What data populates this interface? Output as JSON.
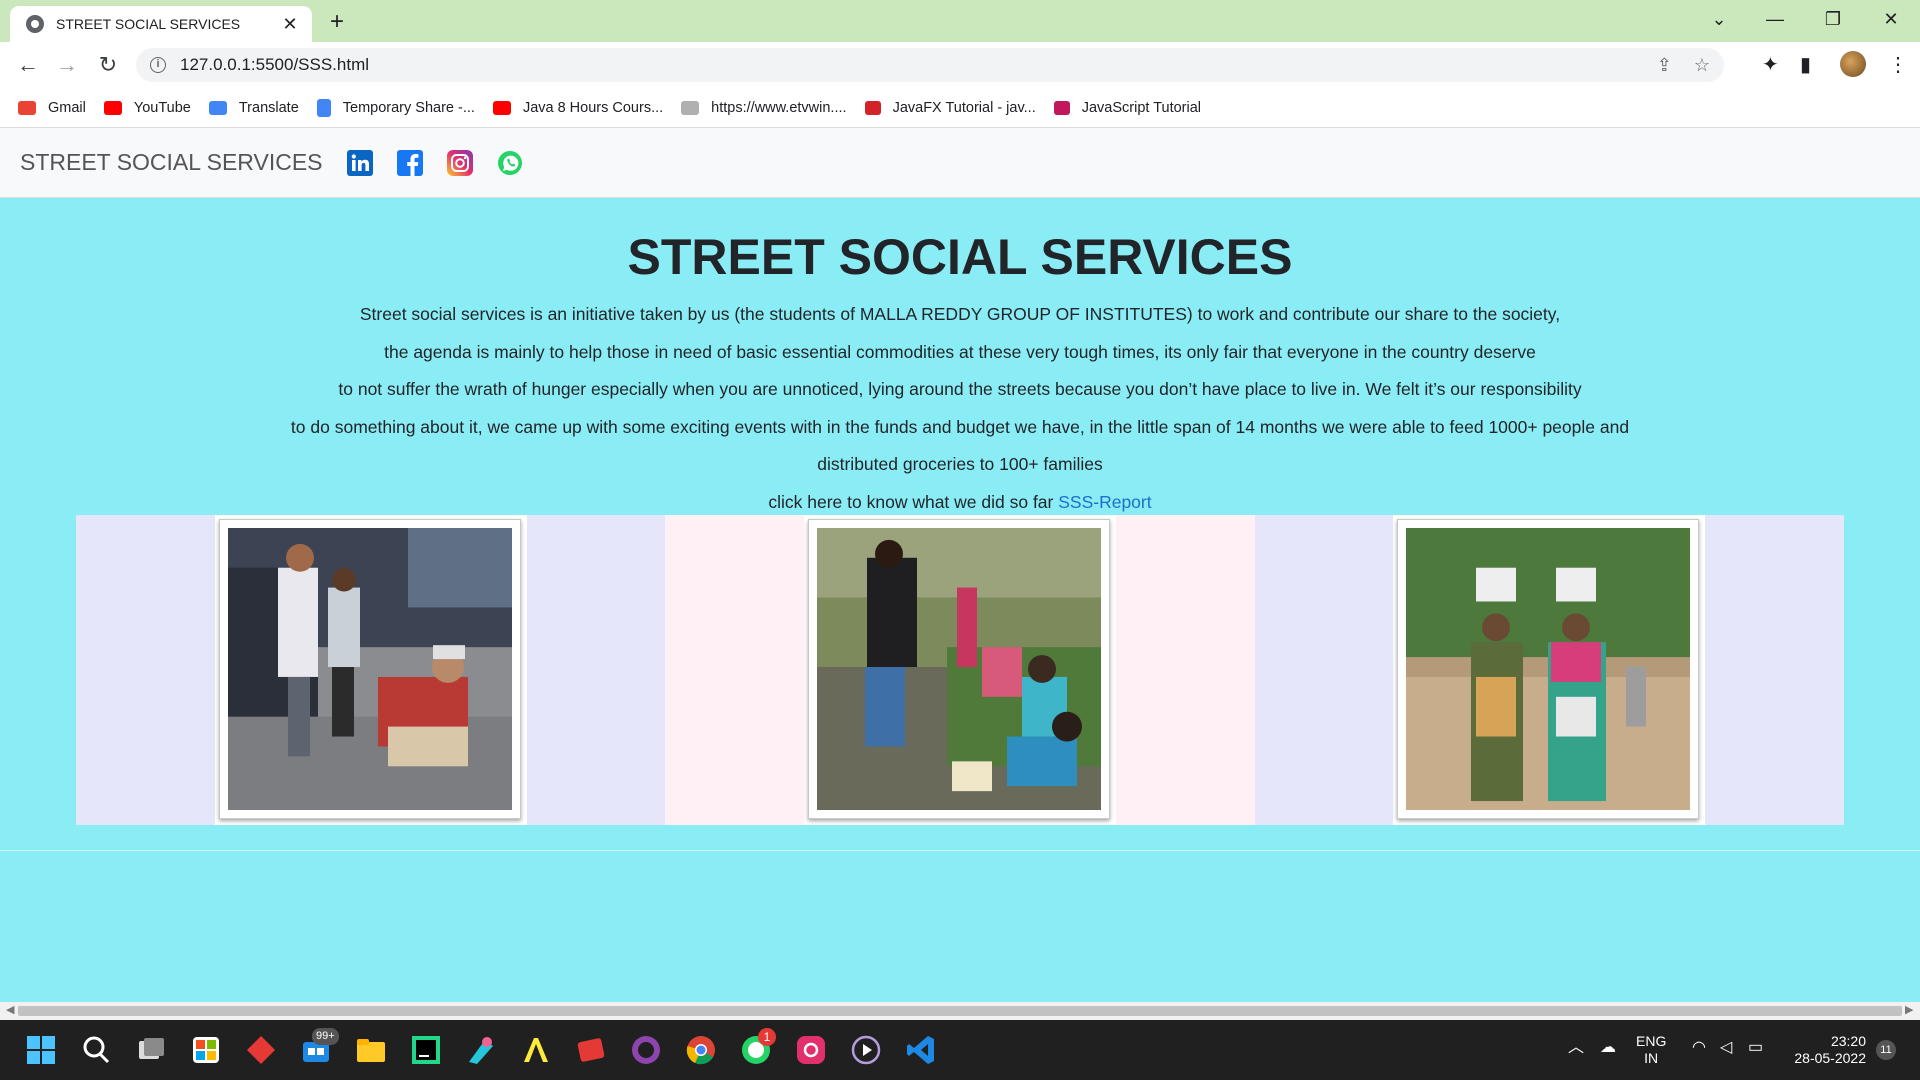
{
  "browser": {
    "tab_title": "STREET SOCIAL SERVICES",
    "tab_close": "✕",
    "new_tab": "+",
    "url": "127.0.0.1:5500/SSS.html",
    "window_controls": [
      "⌄",
      "—",
      "❐",
      "✕"
    ]
  },
  "bookmarks": [
    {
      "label": "Gmail",
      "icon": "gmail-icon",
      "color": "#ea4335"
    },
    {
      "label": "YouTube",
      "icon": "youtube-icon",
      "color": "#ff0000"
    },
    {
      "label": "Translate",
      "icon": "translate-icon",
      "color": "#4285f4"
    },
    {
      "label": "Temporary Share -...",
      "icon": "docs-icon",
      "color": "#4285f4"
    },
    {
      "label": "Java 8 Hours Cours...",
      "icon": "youtube-icon",
      "color": "#ff0000"
    },
    {
      "label": "https://www.etvwin....",
      "icon": "etv-icon",
      "color": "#888888"
    },
    {
      "label": "JavaFX Tutorial - jav...",
      "icon": "javatpoint-icon",
      "color": "#d3222a"
    },
    {
      "label": "JavaScript Tutorial",
      "icon": "tutorial-icon",
      "color": "#c2185b"
    }
  ],
  "page": {
    "brand": "STREET SOCIAL SERVICES",
    "social": [
      "linkedin-icon",
      "facebook-icon",
      "instagram-icon",
      "whatsapp-icon"
    ],
    "heading": "STREET SOCIAL SERVICES",
    "paragraph_lines": [
      "Street social services is an initiative taken by us (the students of MALLA REDDY GROUP OF INSTITUTES) to work and contribute our share to the society,",
      "the agenda is mainly to help those in need of basic essential commodities at these very tough times, its only fair that everyone in the country deserve",
      "to not suffer the wrath of hunger especially when you are unnoticed, lying around the streets because you don’t have place to live in. We felt it’s our responsibility",
      "to do something about it, we came up with some exciting events with in the funds and budget we have, in the little span of 14 months we were able to feed 1000+ people and",
      "distributed groceries to 100+ families"
    ],
    "report_prefix": "click here to know what we did so far ",
    "report_link": "SSS-Report"
  },
  "taskbar": {
    "badge_store": "99+",
    "badge_whatsapp": "1",
    "lang_1": "ENG",
    "lang_2": "IN",
    "time": "23:20",
    "date": "28-05-2022",
    "notifications": "11"
  },
  "colors": {
    "page_bg": "#8aedf5",
    "link": "#1f6ec9",
    "tab_strip": "#cbe8bd"
  }
}
